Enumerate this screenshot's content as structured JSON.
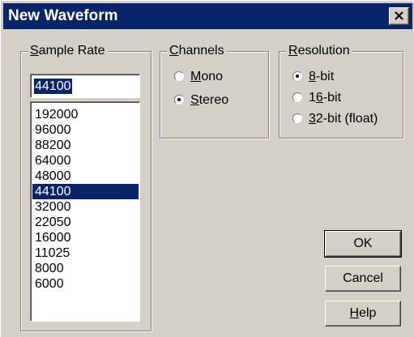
{
  "window": {
    "title": "New Waveform",
    "close_label": "×"
  },
  "sample_rate": {
    "legend_mnemonic": "S",
    "legend_rest": "ample Rate",
    "input_value": "44100",
    "options": [
      "192000",
      "96000",
      "88200",
      "64000",
      "48000",
      "44100",
      "32000",
      "22050",
      "16000",
      "11025",
      "8000",
      "6000"
    ],
    "selected": "44100"
  },
  "channels": {
    "legend_mnemonic": "C",
    "legend_rest": "hannels",
    "mono": {
      "mnemonic": "M",
      "rest": "ono",
      "checked": false
    },
    "stereo": {
      "mnemonic": "S",
      "rest": "tereo",
      "checked": true
    }
  },
  "resolution": {
    "legend_mnemonic": "R",
    "legend_rest": "esolution",
    "bit8": {
      "mnemonic": "8",
      "rest": "-bit",
      "checked": true
    },
    "bit16": {
      "pre": "1",
      "mnemonic": "6",
      "rest": "-bit",
      "checked": false
    },
    "bit32": {
      "mnemonic": "3",
      "rest": "2-bit (float)",
      "checked": false
    }
  },
  "buttons": {
    "ok_label": "OK",
    "cancel_label": "Cancel",
    "help_mnemonic": "H",
    "help_rest": "elp"
  }
}
